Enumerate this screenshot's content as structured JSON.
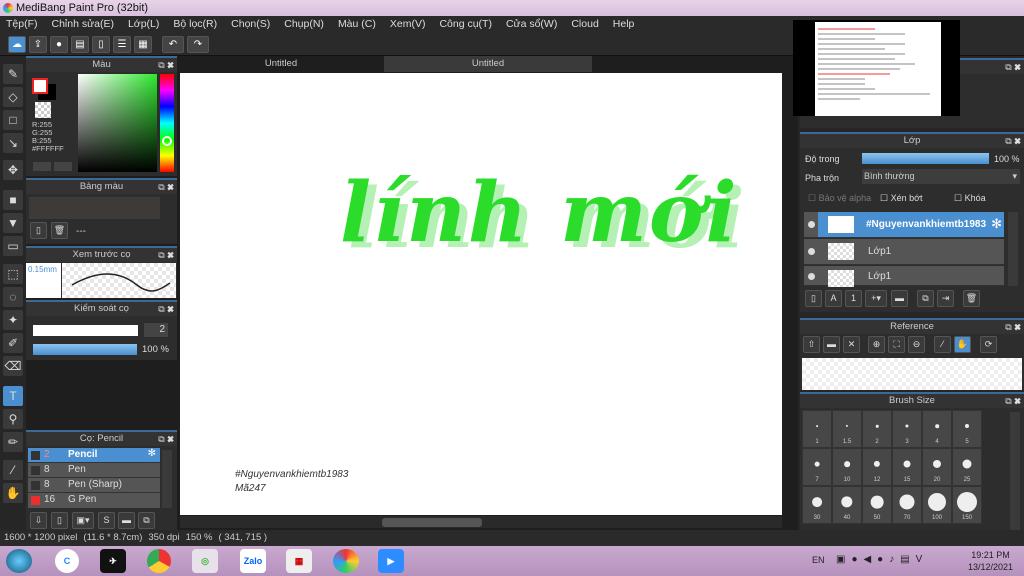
{
  "window": {
    "title": "MediBang Paint Pro (32bit)"
  },
  "menu": [
    "Tệp(F)",
    "Chỉnh sửa(E)",
    "Lớp(L)",
    "Bộ lọc(R)",
    "Chọn(S)",
    "Chụp(N)",
    "Màu (C)",
    "Xem(V)",
    "Công cụ(T)",
    "Cửa sổ(W)",
    "Cloud",
    "Help"
  ],
  "tabs": [
    "Untitled",
    "Untitled"
  ],
  "color_panel": {
    "title": "Màu",
    "r": "R:255",
    "g": "G:255",
    "b": "B:255",
    "hex": "#FFFFFF",
    "primary": "#ffffff",
    "accent": "#39d339"
  },
  "palette_panel": {
    "title": "Bảng màu",
    "dash": "---"
  },
  "brush_preview": {
    "title": "Xem trước cọ",
    "size": "0.15mm"
  },
  "brush_control": {
    "title": "Kiểm soát cọ",
    "size": "2",
    "opacity": "100 %",
    "opacity_value": 100
  },
  "brush_list": {
    "title": "Cọ: Pencil",
    "items": [
      {
        "size": "2",
        "name": "Pencil",
        "color": "#333333",
        "selected": true
      },
      {
        "size": "8",
        "name": "Pen",
        "color": "#333333"
      },
      {
        "size": "8",
        "name": "Pen (Sharp)",
        "color": "#333333"
      },
      {
        "size": "16",
        "name": "G Pen",
        "color": "#e83030"
      }
    ]
  },
  "canvas": {
    "main_text": "lính mới",
    "signature1": "#Nguyenvankhiemtb1983",
    "signature2": "Mã247"
  },
  "layer_panel": {
    "title": "Lớp",
    "opacity_label": "Độ trong",
    "opacity": "100 %",
    "opacity_value": 100,
    "blend_label": "Pha trộn",
    "blend": "Bình thường",
    "protect_alpha": "Bảo vệ alpha",
    "clip": "Xén bớt",
    "lock": "Khóa",
    "layers": [
      {
        "name": "#Nguyenvankhiemtb1983",
        "selected": true
      },
      {
        "name": "Lớp1"
      },
      {
        "name": "Lớp1"
      }
    ]
  },
  "reference_panel": {
    "title": "Reference"
  },
  "brush_size_panel": {
    "title": "Brush Size",
    "sizes": [
      "1",
      "1.5",
      "2",
      "3",
      "4",
      "5",
      "7",
      "10",
      "12",
      "15",
      "20",
      "25",
      "30",
      "40",
      "50",
      "70",
      "100",
      "150"
    ]
  },
  "status": {
    "pixels": "1600 * 1200 pixel",
    "cm": "(11.6 * 8.7cm)",
    "dpi": "350 dpi",
    "zoom": "150 %",
    "coords": "( 341, 715 )"
  },
  "taskbar": {
    "lang": "EN",
    "time": "19:21 PM",
    "date": "13/12/2021",
    "zalo": "Zalo"
  }
}
